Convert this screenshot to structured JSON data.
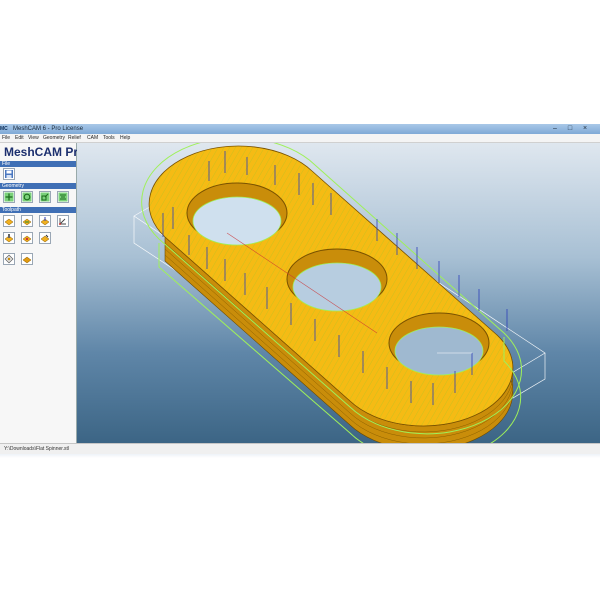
{
  "window": {
    "app_icon_text": "MC",
    "title": "MeshCAM 6 - Pro License",
    "minimize_glyph": "–",
    "maximize_glyph": "□",
    "close_glyph": "×"
  },
  "menu": [
    "File",
    "Edit",
    "View",
    "Geometry",
    "Relief",
    "CAM",
    "Tools",
    "Help"
  ],
  "sidebar": {
    "brand": "MeshCAM Pro",
    "sections": [
      {
        "label": "File",
        "buttons": [
          {
            "icon": "save-icon"
          }
        ]
      },
      {
        "label": "Geometry",
        "buttons": [
          {
            "icon": "move-icon"
          },
          {
            "icon": "rotate-icon"
          },
          {
            "icon": "scale-icon"
          },
          {
            "icon": "align-icon"
          }
        ]
      },
      {
        "label": "Toolpath",
        "buttons": [
          {
            "icon": "toolpath-region-icon"
          },
          {
            "icon": "toolpath-roughing-icon"
          },
          {
            "icon": "toolpath-finishing-icon"
          },
          {
            "icon": "toolpath-origin-icon"
          },
          {
            "icon": "toolpath-tool-icon"
          },
          {
            "icon": "toolpath-rest-icon"
          },
          {
            "icon": "toolpath-pencil-icon"
          },
          {
            "icon": "simulate-icon"
          },
          {
            "icon": "export-gcode-icon"
          }
        ]
      }
    ]
  },
  "colors": {
    "part_top": "#f5bb14",
    "part_side": "#c98d0a",
    "toolpath": "#9ff05a",
    "plunge": "#2c3fb8",
    "stock_box": "#ffffff",
    "accent": "#3f6fb5"
  },
  "statusbar": {
    "file_path": "Y:\\Downloads\\Flat Spinner.stl"
  }
}
